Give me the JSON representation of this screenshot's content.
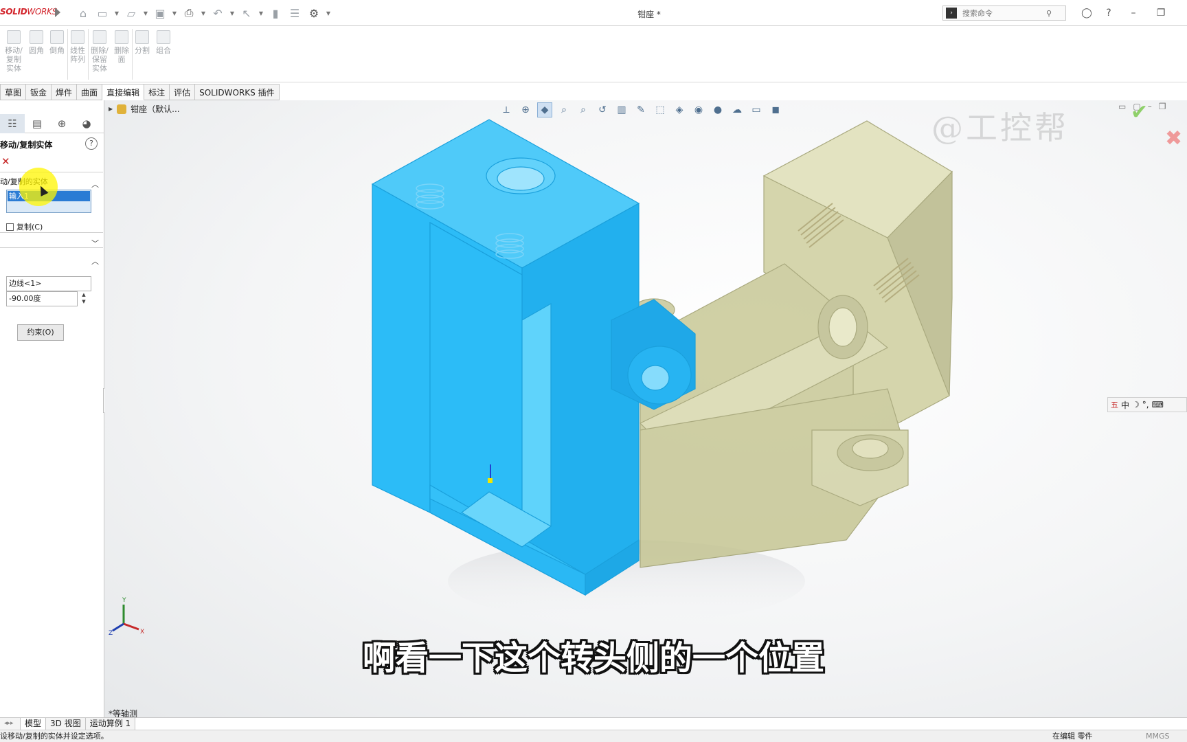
{
  "app": {
    "logo_prefix": "SOLID",
    "logo_suffix": "WORKS",
    "doc_title": "钳座 *"
  },
  "search": {
    "placeholder": "搜索命令"
  },
  "command_manager": {
    "buttons": [
      {
        "label": "移动/\n复制\n实体"
      },
      {
        "label": "圆角"
      },
      {
        "label": "倒角"
      },
      {
        "label": "线性\n阵列"
      },
      {
        "label": "删除/\n保留\n实体"
      },
      {
        "label": "删除\n面"
      },
      {
        "label": "分割"
      },
      {
        "label": "组合"
      }
    ]
  },
  "tabs": [
    {
      "label": "草图"
    },
    {
      "label": "钣金"
    },
    {
      "label": "焊件"
    },
    {
      "label": "曲面"
    },
    {
      "label": "直接编辑"
    },
    {
      "label": "标注"
    },
    {
      "label": "评估"
    },
    {
      "label": "SOLIDWORKS 插件"
    }
  ],
  "property_manager": {
    "title": "移动/复制实体",
    "help": "?",
    "section_bodies": "动/复制的实体",
    "selected_item": "输入1",
    "copy_label": "复制(C)",
    "edge_field": "边线<1>",
    "angle_field": "-90.00度",
    "constraint_button": "约束(O)"
  },
  "graphics": {
    "tree_root": "钳座（默认...",
    "view_name": "*等轴测",
    "ime": {
      "cn": "五",
      "zh": "中"
    },
    "watermark": "@工控帮"
  },
  "subtitle": "啊看一下这个转头侧的一个位置",
  "bottom_tabs": [
    {
      "label": "模型"
    },
    {
      "label": "3D 视图"
    },
    {
      "label": "运动算例 1"
    }
  ],
  "status": {
    "left": "设移动/复制的实体并设定选项。",
    "mid": "在编辑 零件",
    "right": "MMGS"
  },
  "colors": {
    "selected_body": "#2cbcf7",
    "other_body": "#c8c89a",
    "accent": "#2a7bd4"
  }
}
